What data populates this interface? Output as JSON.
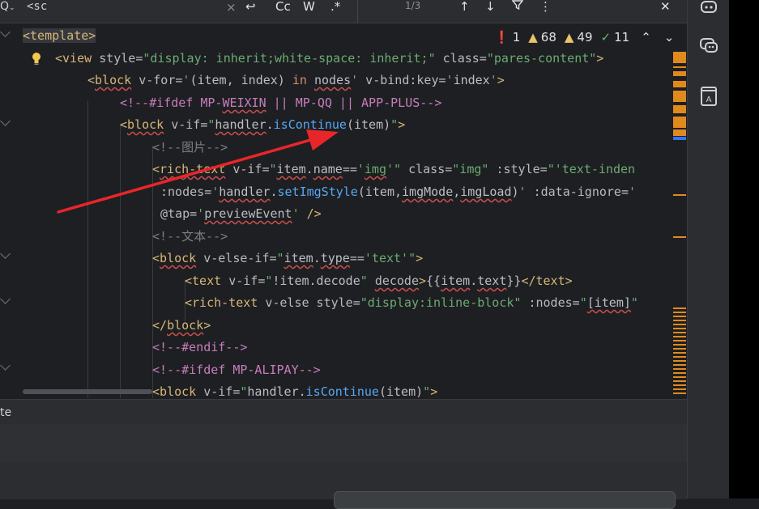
{
  "search": {
    "icon": "search-options-icon",
    "query": "<sc",
    "clear": "×",
    "match_case": "Cc",
    "whole_word": "W",
    "regex": ".*",
    "result_count": "1/3",
    "prev": "↑",
    "next": "↓",
    "filter": "filter-icon",
    "more": "⋮",
    "close": "✕"
  },
  "inspections": {
    "errors": "1",
    "weak_warnings": "68",
    "warnings": "49",
    "ok": "11",
    "up": "⌃",
    "down": "⌄"
  },
  "code_lines": [
    "<template>",
    "<view style=\"display: inherit;white-space: inherit;\" class=\"pares-content\">",
    "<block v-for='(item, index) in nodes' v-bind:key='index'>",
    "<!--#ifdef MP-WEIXIN || MP-QQ || APP-PLUS-->",
    "<block v-if=\"handler.isContinue(item)\">",
    "<!--图片-->",
    "<rich-text v-if=\"item.name=='img'\" class=\"img\" :style=\"'text-inden",
    ":nodes='handler.setImgStyle(item,imgMode,imgLoad)' :data-ignore='",
    "@tap='previewEvent' />",
    "<!--文本-->",
    "<block v-else-if=\"item.type=='text'\">",
    "<text v-if=\"!item.decode\" decode>{{item.text}}</text>",
    "<rich-text v-else style=\"display:inline-block\" :nodes=\"[item]\"",
    "</block>",
    "<!--#endif-->",
    "<!--#ifdef MP-ALIPAY-->",
    "<block v-if=\"handler.isContinue(item)\">"
  ],
  "bottom_panel": {
    "label": "te"
  },
  "colors": {
    "background": "#1e1f22",
    "tag": "#d5b778",
    "string": "#6aab73",
    "function": "#56a8f5",
    "comment": "#7a7e85",
    "keyword": "#cf8e6d",
    "annotation_arrow": "#e8262a"
  },
  "right_icons": [
    "ai-assistant-icon",
    "copilot-chat-icon",
    "dictionary-icon"
  ]
}
